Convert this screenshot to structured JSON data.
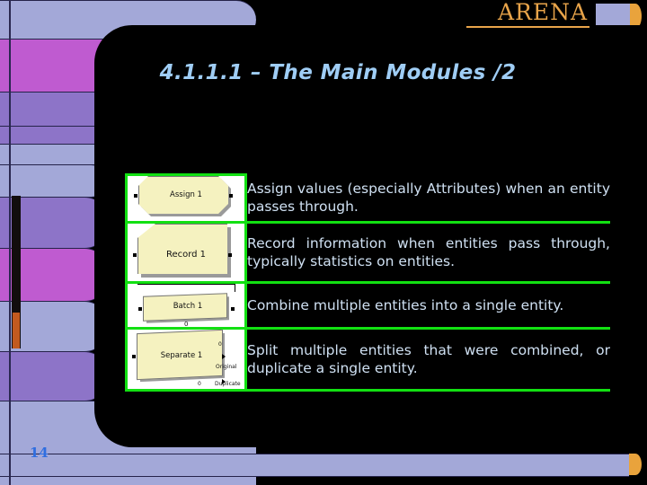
{
  "header": {
    "brand": "ARENA"
  },
  "title": "4.1.1.1 – The Main Modules /2",
  "page_number": "14",
  "colors": {
    "title_blue": "#9fcdf5",
    "brand_orange": "#e8a44a",
    "grid_green": "#12e012",
    "body_text": "#cfe0f2",
    "module_fill": "#f5f2c0",
    "band_periwinkle": "#a3a8d8",
    "band_magenta": "#bf5bd0",
    "band_purple": "#8d74c8"
  },
  "table": {
    "rows": [
      {
        "module": {
          "name": "Assign 1",
          "shape": "octagon",
          "icon": "assign-module-icon",
          "labels": []
        },
        "description": "Assign values (especially Attributes) when an entity passes through."
      },
      {
        "module": {
          "name": "Record 1",
          "shape": "clipped-corner-rectangle",
          "icon": "record-module-icon",
          "labels": []
        },
        "description": "Record information when entities pass through, typically statistics on entities."
      },
      {
        "module": {
          "name": "Batch 1",
          "shape": "flat-parallelogram",
          "icon": "batch-module-icon",
          "labels": [
            "0"
          ]
        },
        "description": "Combine multiple entities into a single entity."
      },
      {
        "module": {
          "name": "Separate 1",
          "shape": "skewed-rectangle",
          "icon": "separate-module-icon",
          "labels": [
            "0",
            "Original",
            "0",
            "Duplicate"
          ]
        },
        "description": "Split multiple entities that were combined, or duplicate a single entity."
      }
    ]
  }
}
